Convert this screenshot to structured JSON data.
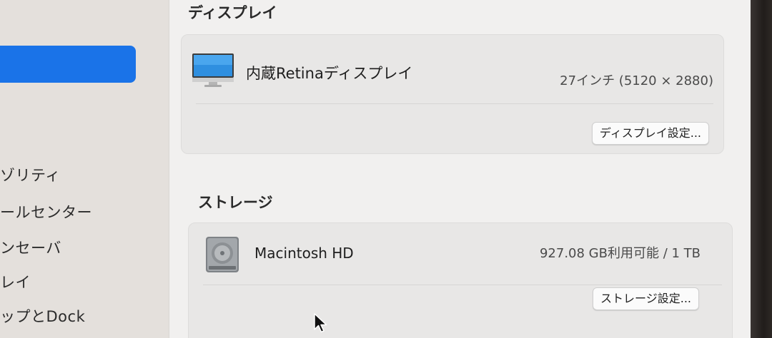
{
  "sidebar": {
    "items": [
      {
        "label": "ゾリティ"
      },
      {
        "label": "ールセンター"
      },
      {
        "label": "ンセーバ"
      },
      {
        "label": "レイ"
      },
      {
        "label": "ップとDock"
      }
    ]
  },
  "display_section": {
    "heading": "ディスプレイ",
    "name": "内蔵Retinaディスプレイ",
    "detail": "27インチ (5120 × 2880)",
    "settings_button": "ディスプレイ設定..."
  },
  "storage_section": {
    "heading": "ストレージ",
    "name": "Macintosh HD",
    "detail": "927.08 GB利用可能 / 1 TB",
    "settings_button": "ストレージ設定..."
  },
  "colors": {
    "accent": "#1a73e8",
    "background": "#f1f0ef",
    "sidebar": "#e4e0dc"
  },
  "icons": [
    "imac-display-icon",
    "hard-disk-icon",
    "mouse-cursor-icon"
  ]
}
